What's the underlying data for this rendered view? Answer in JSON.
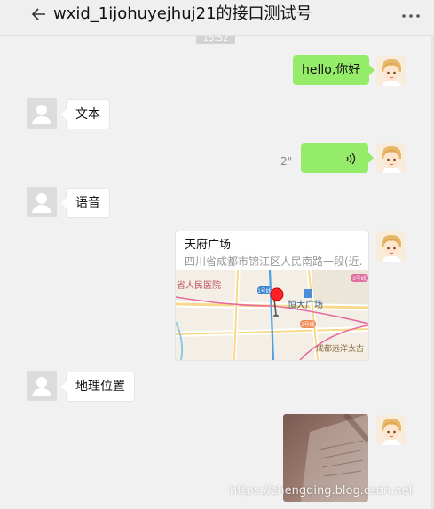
{
  "header": {
    "title": "wxid_1ijohuyejhuj21的接口测试号"
  },
  "timestamp": "15:52",
  "messages": {
    "outgoing_text": "hello,你好",
    "incoming_text": "文本",
    "voice_duration": "2\"",
    "incoming_voice_label": "语音",
    "location": {
      "name": "天府广场",
      "address": "四川省成都市锦江区人民南路一段(近...",
      "map_labels": {
        "hospital": "省人民医院",
        "square": "恒大广场",
        "metro_line_1": "1号线",
        "metro_line_2": "2号线",
        "metro_line_3": "3号线",
        "mall": "成都远洋太古"
      }
    },
    "incoming_location_label": "地理位置"
  },
  "watermark": "https://zhengqing.blog.csdn.net",
  "colors": {
    "bubble_out": "#95ec69",
    "bubble_in": "#ffffff",
    "background": "#f1f1f1",
    "map_pin": "#ff1f1f"
  }
}
